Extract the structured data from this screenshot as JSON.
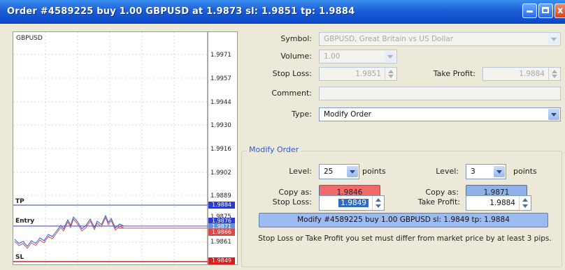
{
  "window": {
    "title": "Order #4589225 buy 1.00 GBPUSD at 1.9873 sl: 1.9851 tp: 1.9884",
    "close_glyph": "x"
  },
  "chart": {
    "symbol": "GBPUSD",
    "price_labels": [
      "1.9971",
      "1.9957",
      "1.9944",
      "1.9930",
      "1.9916",
      "1.9902",
      "1.9889",
      "1.9875",
      "1.9861"
    ],
    "level_labels": {
      "tp": "TP",
      "entry": "Entry",
      "sl": "SL"
    },
    "tags": {
      "tp": "1.9884",
      "entry_top": "1.9876",
      "entry_a": "1.9871",
      "entry_b": "1.9866",
      "sl": "1.9849"
    },
    "colors": {
      "tp": "#2a3cc8",
      "entry": "#2a3cc8",
      "sl": "#cc2222",
      "bid": "#2a5bd7",
      "ask": "#d84a4a"
    }
  },
  "form": {
    "symbol_label": "Symbol:",
    "symbol_value": "GBPUSD, Great Britain vs US Dollar",
    "volume_label": "Volume:",
    "volume_value": "1.00",
    "stop_loss_label": "Stop Loss:",
    "stop_loss_value": "1.9851",
    "take_profit_label": "Take Profit:",
    "take_profit_value": "1.9884",
    "comment_label": "Comment:",
    "comment_value": "",
    "type_label": "Type:",
    "type_value": "Modify Order"
  },
  "modify": {
    "group_title": "Modify Order",
    "level_label": "Level:",
    "level_left": "25",
    "level_right": "3",
    "points_label": "points",
    "copy_as_label": "Copy as:",
    "copy_red": "1.9846",
    "copy_blue": "1.9871",
    "stop_loss_label": "Stop Loss:",
    "stop_loss_value": "1.9849",
    "take_profit_label": "Take Profit:",
    "take_profit_value": "1.9884",
    "modify_button": "Modify #4589225 buy 1.00 GBPUSD sl: 1.9849 tp: 1.9884",
    "note": "Stop Loss or Take Profit you set must differ from market price by at least 3 pips."
  }
}
